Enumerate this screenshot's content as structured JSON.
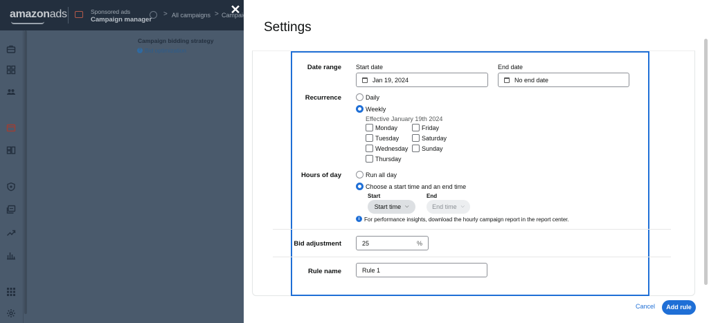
{
  "background_app": {
    "logo": {
      "bold": "amazon",
      "thin": "ads"
    },
    "product": {
      "line1": "Sponsored ads",
      "line2": "Campaign manager"
    },
    "breadcrumb": {
      "home_icon": "home-icon",
      "separator": ">",
      "all_campaigns": "All campaigns",
      "next": "Campaign"
    },
    "sidenav_icons": [
      "briefcase-icon",
      "dashboard-icon",
      "users-icon",
      "campaign-icon",
      "ad-groups-icon",
      "shield-icon",
      "reports-icon",
      "trend-icon",
      "bar-chart-icon",
      "apps-grid-icon",
      "settings-icon"
    ],
    "content": {
      "strategy_label": "Campaign bidding strategy",
      "bid_optimization": "Bid optimization"
    }
  },
  "close_button": {
    "glyph": "✕",
    "icon": "close-icon"
  },
  "settings": {
    "title": "Settings",
    "date_range": {
      "label": "Date range",
      "start_label": "Start date",
      "start_value": "Jan 19, 2024",
      "end_label": "End date",
      "end_value": "No end date",
      "icon": "calendar-icon"
    },
    "recurrence": {
      "label": "Recurrence",
      "options": [
        {
          "label": "Daily",
          "selected": false
        },
        {
          "label": "Weekly",
          "selected": true
        }
      ],
      "effective_text": "Effective January 19th 2024",
      "days": [
        {
          "label": "Monday",
          "checked": false
        },
        {
          "label": "Tuesday",
          "checked": false
        },
        {
          "label": "Wednesday",
          "checked": false
        },
        {
          "label": "Thursday",
          "checked": false
        },
        {
          "label": "Friday",
          "checked": false
        },
        {
          "label": "Saturday",
          "checked": false
        },
        {
          "label": "Sunday",
          "checked": false
        }
      ]
    },
    "hours_of_day": {
      "label": "Hours of day",
      "options": [
        {
          "label": "Run all day",
          "selected": false
        },
        {
          "label": "Choose a start time and an end time",
          "selected": true
        }
      ],
      "start_label": "Start",
      "start_value": "Start time",
      "end_label": "End",
      "end_value": "End time",
      "info_text": "For performance insights, download the hourly campaign report in the report center."
    },
    "bid_adjustment": {
      "label": "Bid adjustment",
      "value": "25",
      "unit": "%"
    },
    "rule_name": {
      "label": "Rule name",
      "value": "Rule 1"
    }
  },
  "footer": {
    "cancel": "Cancel",
    "add_rule": "Add rule"
  },
  "colors": {
    "accent": "#1f6fd6",
    "topbar": "#232f3e",
    "overlay": "#4a5a6c"
  }
}
